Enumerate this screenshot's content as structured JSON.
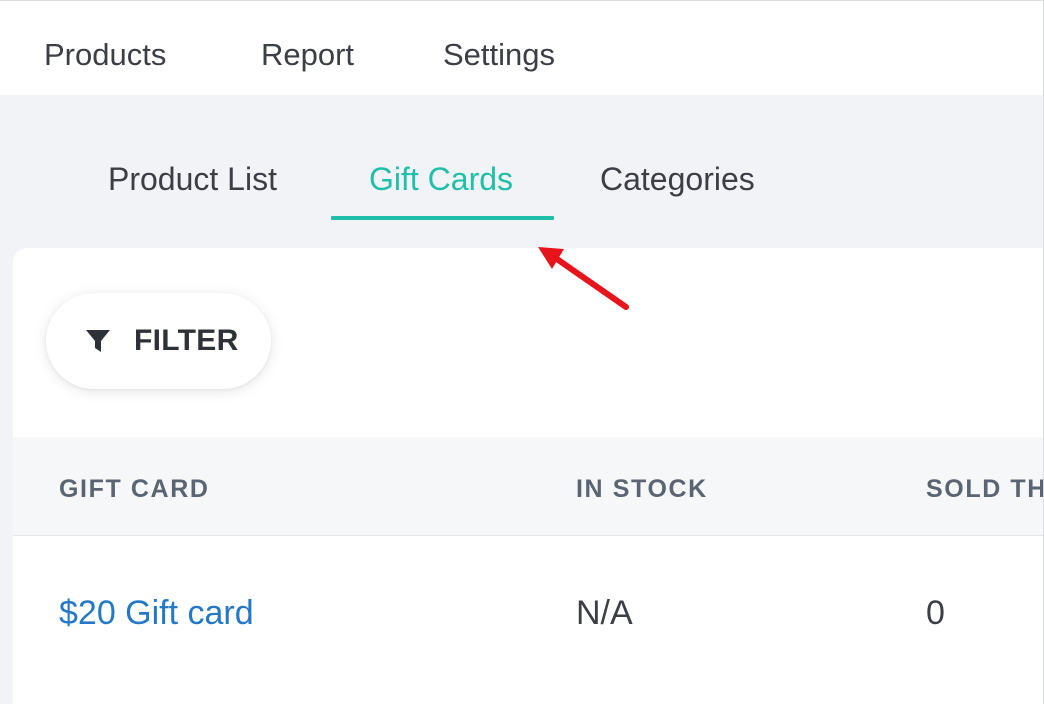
{
  "topnav": {
    "items": [
      {
        "label": "Products"
      },
      {
        "label": "Report"
      },
      {
        "label": "Settings"
      }
    ]
  },
  "subtabs": {
    "items": [
      {
        "label": "Product List",
        "active": false
      },
      {
        "label": "Gift Cards",
        "active": true
      },
      {
        "label": "Categories",
        "active": false
      }
    ]
  },
  "filter": {
    "label": "FILTER",
    "icon": "filter-icon"
  },
  "table": {
    "columns": [
      "GIFT CARD",
      "IN STOCK",
      "SOLD TH"
    ],
    "rows": [
      {
        "gift_card": "$20 Gift card",
        "in_stock": "N/A",
        "sold": "0"
      }
    ]
  },
  "colors": {
    "accent": "#1fbfaa",
    "link": "#2478c8",
    "annotation": "#e8141c",
    "background": "#f2f3f6"
  }
}
